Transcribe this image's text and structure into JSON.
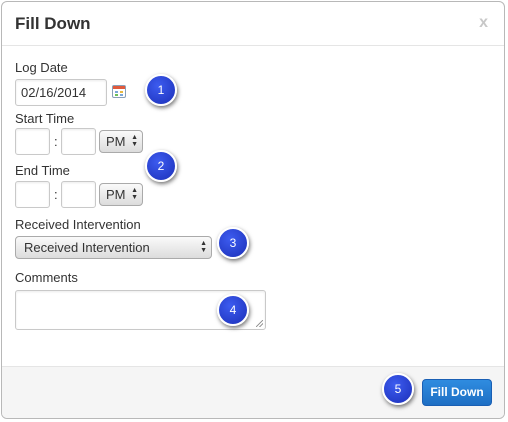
{
  "dialog": {
    "title": "Fill Down",
    "close_label": "x"
  },
  "form": {
    "log_date": {
      "label": "Log Date",
      "value": "02/16/2014"
    },
    "start_time": {
      "label": "Start Time",
      "hour": "",
      "minute": "",
      "separator": ":",
      "ampm": "PM"
    },
    "end_time": {
      "label": "End Time",
      "hour": "",
      "minute": "",
      "separator": ":",
      "ampm": "PM"
    },
    "received_intervention": {
      "label": "Received Intervention",
      "selected": "Received Intervention"
    },
    "comments": {
      "label": "Comments",
      "value": ""
    }
  },
  "footer": {
    "submit_label": "Fill Down"
  },
  "callouts": [
    "1",
    "2",
    "3",
    "4",
    "5"
  ],
  "colors": {
    "primary_button": "#2a7fd4",
    "callout": "#2740d8"
  },
  "icons": [
    "calendar-icon",
    "select-arrows-icon",
    "resize-grip-icon",
    "close-icon"
  ]
}
